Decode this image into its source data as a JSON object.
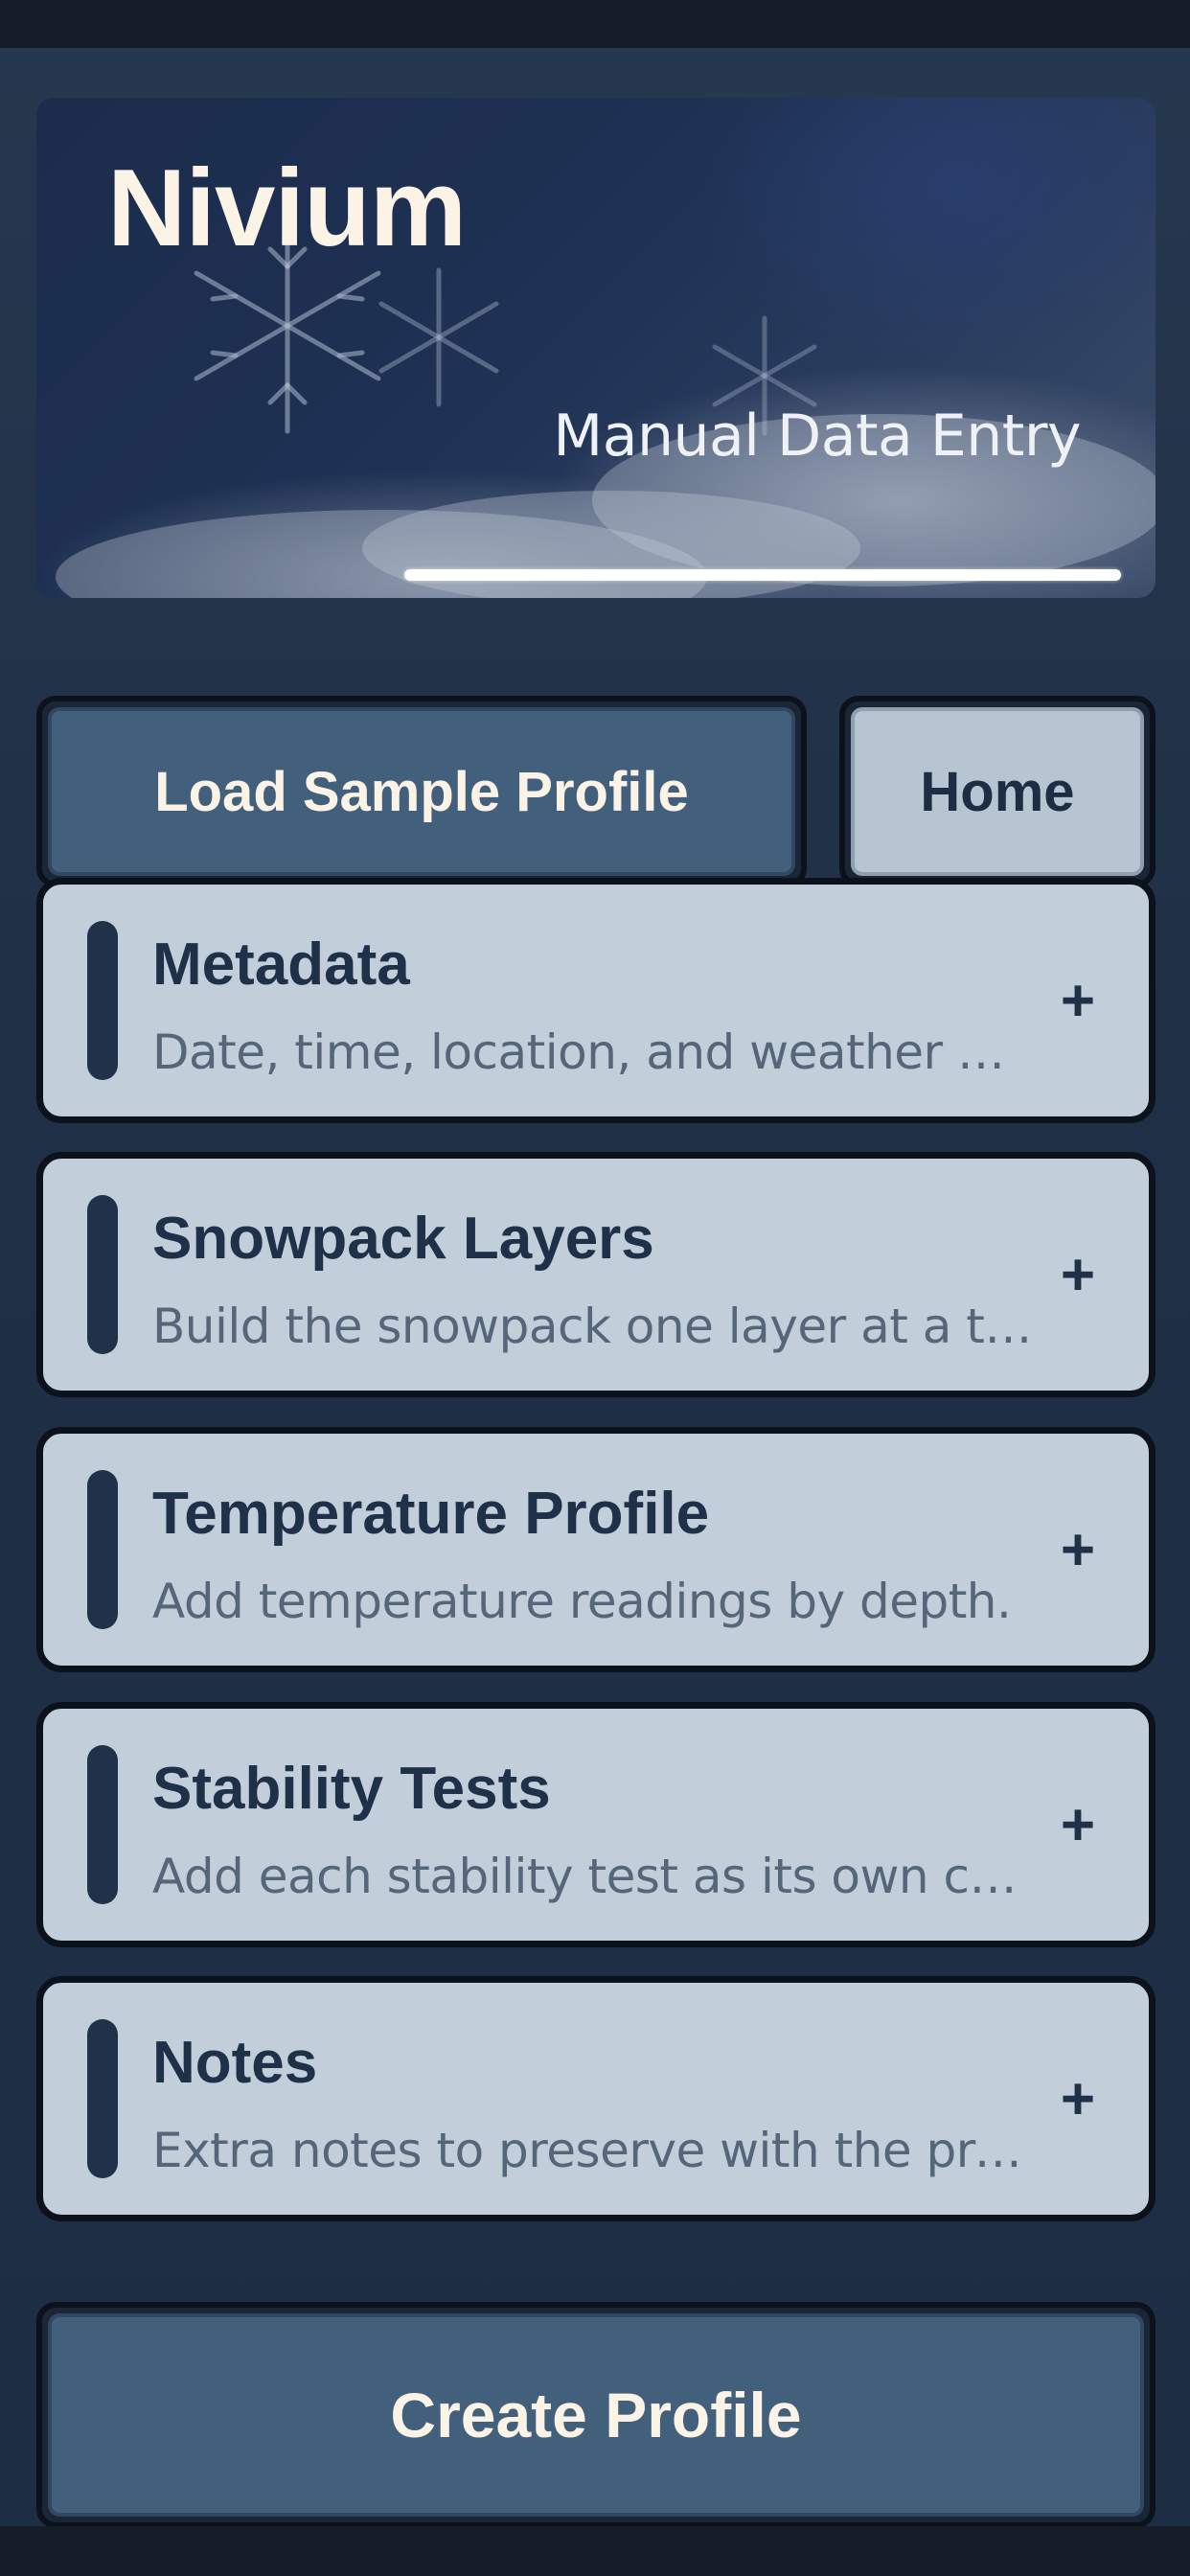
{
  "header": {
    "title": "Nivium",
    "subtitle": "Manual Data Entry"
  },
  "actions": {
    "load_sample_label": "Load Sample Profile",
    "home_label": "Home",
    "create_label": "Create Profile"
  },
  "sections": [
    {
      "title": "Metadata",
      "description": "Date, time, location, and weather detai…",
      "icon": "plus-icon"
    },
    {
      "title": "Snowpack Layers",
      "description": "Build the snowpack one layer at a time.",
      "icon": "plus-icon"
    },
    {
      "title": "Temperature Profile",
      "description": "Add temperature readings by depth.",
      "icon": "plus-icon"
    },
    {
      "title": "Stability Tests",
      "description": "Add each stability test as its own card.",
      "icon": "plus-icon"
    },
    {
      "title": "Notes",
      "description": "Extra notes to preserve with the profile.",
      "icon": "plus-icon"
    }
  ],
  "expand_glyph": "+",
  "colors": {
    "background": "#1f3046",
    "card": "#c2ced9",
    "primary_button": "#42607c",
    "secondary_button": "#b7c4d1",
    "text_dark": "#1f3049",
    "title_cream": "#fbf3e6"
  }
}
